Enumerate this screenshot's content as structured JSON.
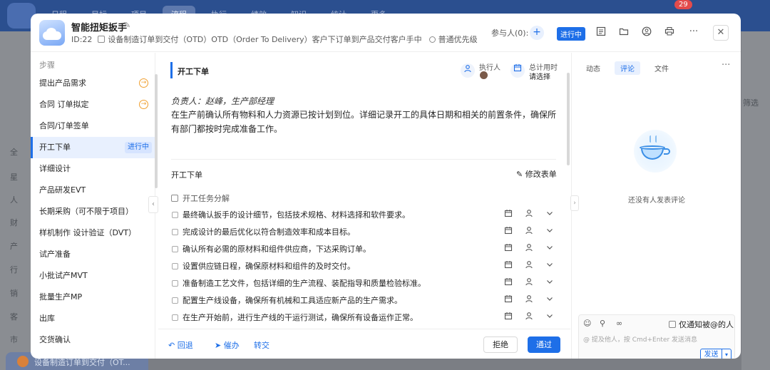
{
  "background": {
    "nav": [
      "日程",
      "目标",
      "项目",
      "流程",
      "执行",
      "绩效",
      "知识",
      "统计",
      "更多"
    ],
    "active_nav_index": 3,
    "notification_count": "29",
    "left_items": [
      "全",
      "星",
      "人",
      "财",
      "产",
      "行",
      "销",
      "客",
      "市"
    ],
    "right_text": "筛选",
    "bottom_tab": "设备制造订单到交付（OT..."
  },
  "header": {
    "title": "智能扭矩扳手",
    "id_text": "ID:22",
    "flow_text": "设备制造订单到交付（OTD）OTD（Order To Delivery）客户下订单到产品交付客户手中",
    "priority": "普通优先级",
    "participants_label": "参与人(0):",
    "add_symbol": "+",
    "status": "进行中",
    "close_symbol": "✕",
    "more_symbol": "···"
  },
  "steps": {
    "title": "步骤",
    "items": [
      {
        "label": "提出产品需求",
        "marker": "arrow"
      },
      {
        "label": "合同 订单拟定",
        "marker": "arrow"
      },
      {
        "label": "合同/订单签单",
        "marker": ""
      },
      {
        "label": "开工下单",
        "marker": "tag",
        "tag": "进行中"
      },
      {
        "label": "详细设计",
        "marker": ""
      },
      {
        "label": "产品研发EVT",
        "marker": ""
      },
      {
        "label": "长期采购（可不限于项目）",
        "marker": ""
      },
      {
        "label": "样机制作 设计验证（DVT）",
        "marker": ""
      },
      {
        "label": "试产准备",
        "marker": ""
      },
      {
        "label": "小批试产MVT",
        "marker": ""
      },
      {
        "label": "批量生产MP",
        "marker": ""
      },
      {
        "label": "出库",
        "marker": ""
      },
      {
        "label": "交货确认",
        "marker": ""
      }
    ],
    "active_index": 3
  },
  "main": {
    "section_title": "开工下单",
    "executor_label": "执行人",
    "total_time_label": "总计用时",
    "total_time_value": "请选择",
    "owner": "负责人：赵峰，生产部经理",
    "description": "在生产前确认所有物料和人力资源已按计划到位。详细记录开工的具体日期和相关的前置条件，确保所有部门都按时完成准备工作。",
    "form_title": "开工下单",
    "edit_form": "修改表单",
    "task_group": "开工任务分解",
    "tasks": [
      "最终确认扳手的设计细节，包括技术规格、材料选择和软件要求。",
      "完成设计的最后优化以符合制造效率和成本目标。",
      "确认所有必需的原材料和组件供应商，下达采购订单。",
      "设置供应链日程，确保原材料和组件的及时交付。",
      "准备制造工艺文件，包括详细的生产流程、装配指导和质量检验标准。",
      "配置生产线设备，确保所有机械和工具适应新产品的生产需求。",
      "在生产开始前，进行生产线的干运行测试，确保所有设备运作正常。"
    ]
  },
  "footer": {
    "back": "回退",
    "urge": "催办",
    "transfer": "转交",
    "reject": "拒绝",
    "pass": "通过"
  },
  "panel": {
    "tabs": [
      "动态",
      "评论",
      "文件"
    ],
    "active_tab": 1,
    "empty_text": "还没有人发表评论",
    "notify_label": "仅通知被@的人",
    "placeholder": "@ 提及他人，按 Cmd+Enter 发送消息",
    "send": "发送"
  },
  "colors": {
    "accent": "#1e6fe8",
    "warning": "#f0a030"
  }
}
